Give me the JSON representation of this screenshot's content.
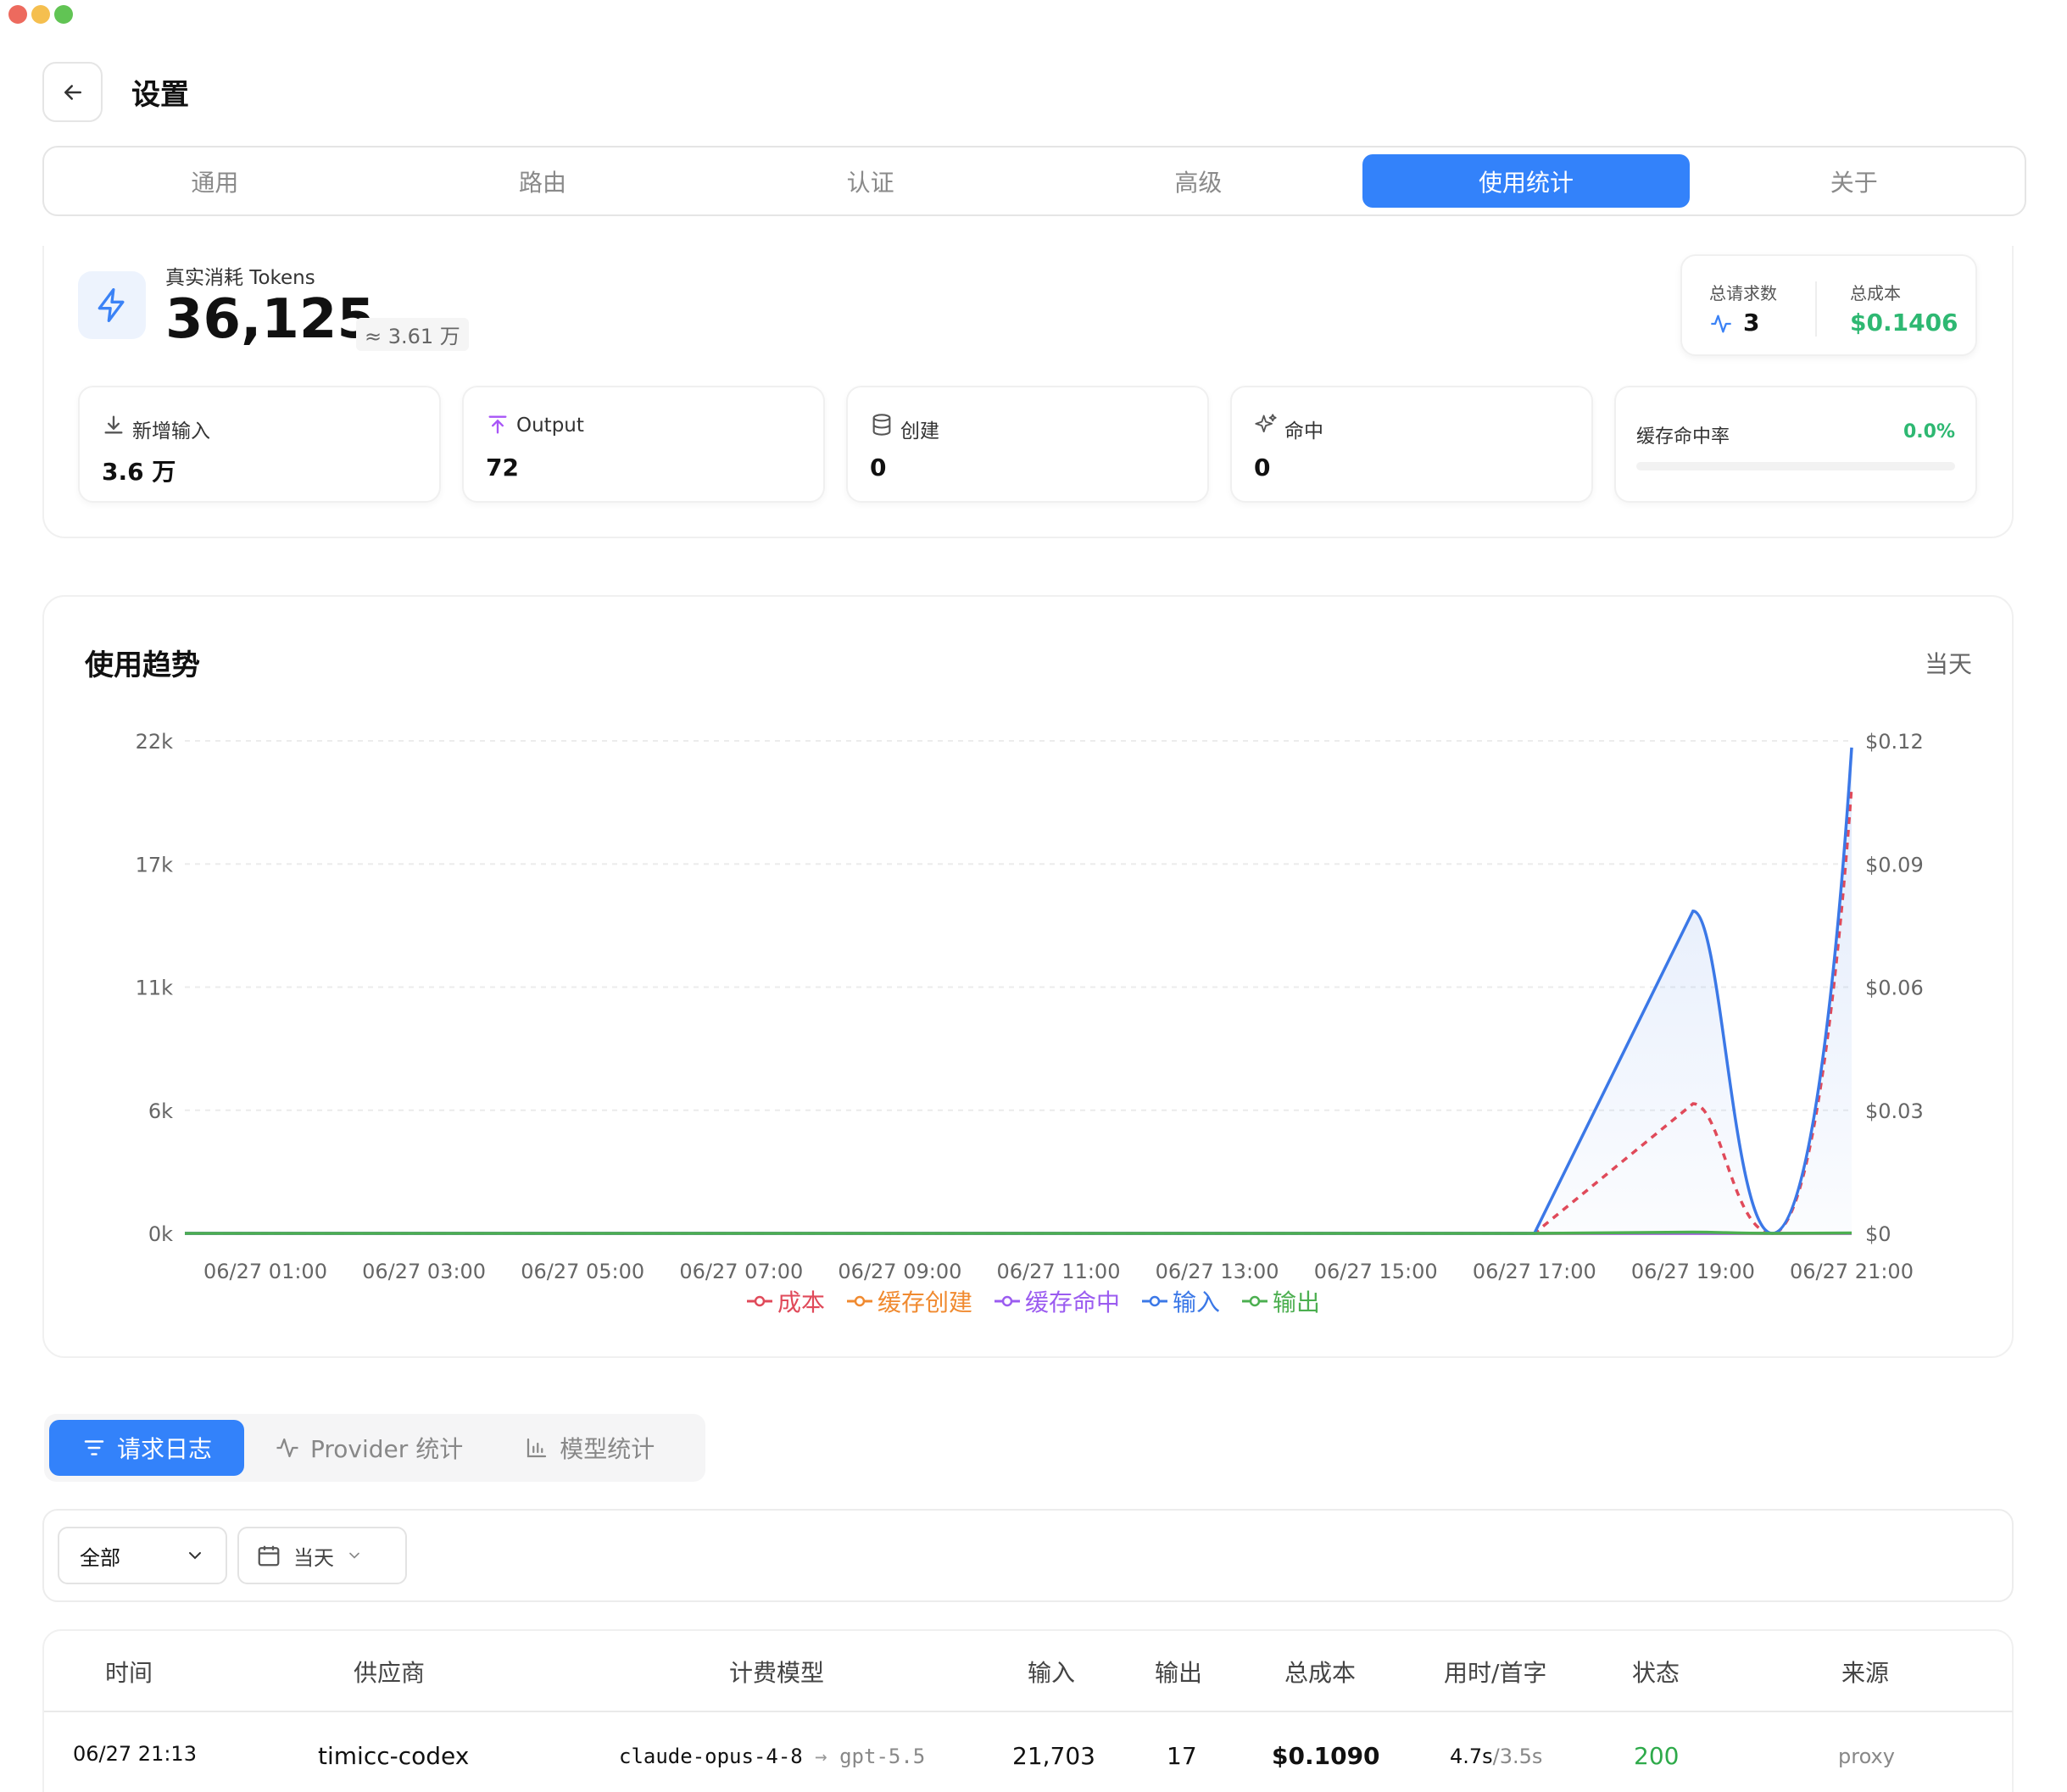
{
  "window": {
    "title": "设置"
  },
  "tabs": [
    "通用",
    "路由",
    "认证",
    "高级",
    "使用统计",
    "关于"
  ],
  "active_tab": "使用统计",
  "tokens": {
    "label": "真实消耗 Tokens",
    "value": "36,125",
    "approx": "≈ 3.61 万"
  },
  "summary": {
    "requests_label": "总请求数",
    "requests_value": "3",
    "cost_label": "总成本",
    "cost_value": "$0.1406"
  },
  "metrics": [
    {
      "label": "新增输入",
      "value": "3.6 万",
      "icon": "download-icon"
    },
    {
      "label": "Output",
      "value": "72",
      "icon": "upload-icon"
    },
    {
      "label": "创建",
      "value": "0",
      "icon": "database-icon"
    },
    {
      "label": "命中",
      "value": "0",
      "icon": "sparkles-icon"
    }
  ],
  "cache_rate": {
    "label": "缓存命中率",
    "value": "0.0%",
    "fraction": 0.0
  },
  "trend": {
    "title": "使用趋势",
    "range": "当天"
  },
  "chart_data": {
    "type": "line",
    "x": [
      "06/27 01:00",
      "06/27 03:00",
      "06/27 05:00",
      "06/27 07:00",
      "06/27 09:00",
      "06/27 11:00",
      "06/27 13:00",
      "06/27 15:00",
      "06/27 17:00",
      "06/27 19:00",
      "06/27 21:00"
    ],
    "y_left_ticks": [
      "22k",
      "17k",
      "11k",
      "6k",
      "0k"
    ],
    "y_right_ticks": [
      "$0.12",
      "$0.09",
      "$0.06",
      "$0.03",
      "$0"
    ],
    "ylim_left": [
      0,
      22000
    ],
    "ylim_right": [
      0,
      0.12
    ],
    "series": [
      {
        "name": "成本",
        "color": "#e04a5a",
        "axis": "right",
        "values": [
          0,
          0,
          0,
          0,
          0,
          0,
          0,
          0,
          0,
          0.0316,
          0.109
        ]
      },
      {
        "name": "缓存创建",
        "color": "#f08a30",
        "axis": "left",
        "values": [
          0,
          0,
          0,
          0,
          0,
          0,
          0,
          0,
          0,
          0,
          0
        ]
      },
      {
        "name": "缓存命中",
        "color": "#9b5cf0",
        "axis": "left",
        "values": [
          0,
          0,
          0,
          0,
          0,
          0,
          0,
          0,
          0,
          0,
          0
        ]
      },
      {
        "name": "输入",
        "color": "#3b78e7",
        "axis": "left",
        "values": [
          0,
          0,
          0,
          0,
          0,
          0,
          0,
          0,
          0,
          14400,
          21703
        ]
      },
      {
        "name": "输出",
        "color": "#4caf50",
        "axis": "left",
        "values": [
          0,
          0,
          0,
          0,
          0,
          0,
          0,
          0,
          0,
          55,
          17
        ]
      }
    ],
    "legend_position": "bottom",
    "grid": true
  },
  "subtabs": [
    {
      "label": "请求日志",
      "icon": "filter-icon",
      "active": true
    },
    {
      "label": "Provider 统计",
      "icon": "activity-icon",
      "active": false
    },
    {
      "label": "模型统计",
      "icon": "bar-chart-icon",
      "active": false
    }
  ],
  "filters": {
    "scope": "全部",
    "date": "当天"
  },
  "table": {
    "headers": [
      "时间",
      "供应商",
      "计费模型",
      "输入",
      "输出",
      "总成本",
      "用时/首字",
      "状态",
      "来源"
    ],
    "rows": [
      {
        "time": "06/27 21:13",
        "provider": "timicc-codex",
        "model_from": "claude-opus-4-8",
        "model_to": "gpt-5.5",
        "input": "21,703",
        "output": "17",
        "cost": "$0.1090",
        "duration": "4.7s",
        "first_token": "/3.5s",
        "status": "200",
        "source": "proxy"
      }
    ]
  }
}
